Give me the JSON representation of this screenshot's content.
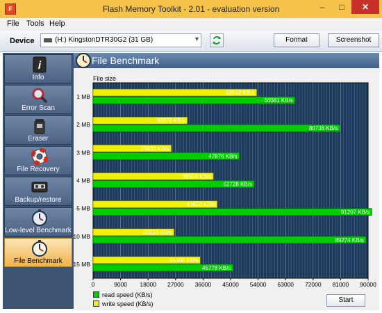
{
  "window": {
    "title": "Flash Memory Toolkit - 2.01 - evaluation version"
  },
  "menu": [
    "File",
    "Tools",
    "Help"
  ],
  "device": {
    "label": "Device",
    "selected": "(H:) KingstonDTR30G2 (31 GB)"
  },
  "toolbar": {
    "format_label": "Format",
    "screenshot_label": "Screenshot"
  },
  "sidebar": {
    "items": [
      {
        "label": "Info",
        "icon": "info-icon"
      },
      {
        "label": "Error Scan",
        "icon": "magnifier-icon"
      },
      {
        "label": "Eraser",
        "icon": "trash-bin-icon"
      },
      {
        "label": "File Recovery",
        "icon": "lifebuoy-icon"
      },
      {
        "label": "Backup/restore",
        "icon": "tape-cassette-icon"
      },
      {
        "label": "Low-level Benchmark",
        "icon": "stopwatch-icon"
      },
      {
        "label": "File Benchmark",
        "icon": "stopwatch-icon",
        "active": true
      }
    ]
  },
  "panel": {
    "title": "File Benchmark"
  },
  "chart_data": {
    "type": "bar",
    "orientation": "horizontal",
    "ylabel": "File size",
    "categories": [
      "1 MB",
      "2 MB",
      "3 MB",
      "4 MB",
      "5 MB",
      "10 MB",
      "15 MB"
    ],
    "series": [
      {
        "name": "write speed (KB/s)",
        "color": "#f0f000",
        "values": [
          53562,
          30870,
          25630,
          39356,
          40650,
          26510,
          35100
        ]
      },
      {
        "name": "read speed (KB/s)",
        "color": "#00cc00",
        "values": [
          66081,
          80738,
          47876,
          52728,
          91207,
          89274,
          45778
        ]
      }
    ],
    "value_suffix": " KB/s",
    "xlim": [
      0,
      90000
    ],
    "xticks": [
      0,
      9000,
      18000,
      27000,
      36000,
      45000,
      54000,
      63000,
      72000,
      81000,
      90000
    ],
    "background": "#1d3a5c",
    "grid": true,
    "legend_position": "bottom-left"
  },
  "legend": [
    {
      "label": "read speed (KB/s)",
      "color": "#00cc00"
    },
    {
      "label": "write speed (KB/s)",
      "color": "#f0f000"
    }
  ],
  "actions": {
    "start_label": "Start"
  }
}
